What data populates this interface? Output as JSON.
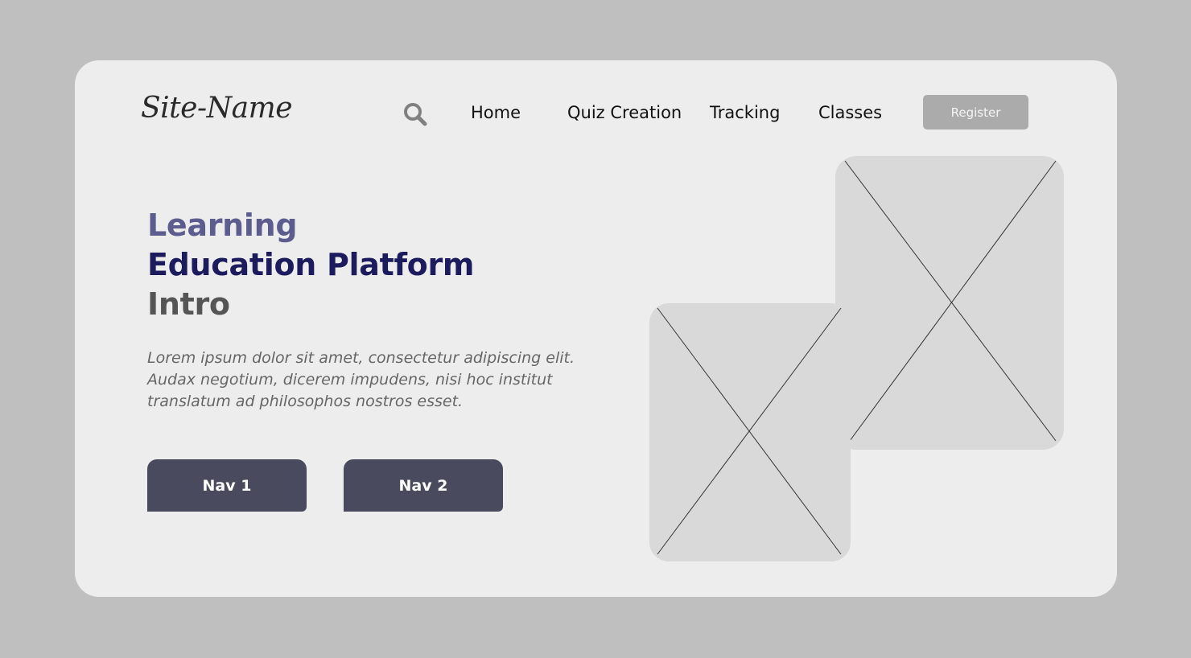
{
  "header": {
    "site_name": "Site-Name",
    "nav": [
      {
        "label": "Home"
      },
      {
        "label": "Quiz Creation"
      },
      {
        "label": "Tracking"
      },
      {
        "label": "Classes"
      }
    ],
    "register_label": "Register",
    "search_icon": "search-icon"
  },
  "hero": {
    "line1": "Learning",
    "line2": "Education Platform",
    "line3": "Intro",
    "description": [
      "Lorem ipsum dolor sit amet, consectetur adipiscing elit.",
      "Audax negotium, dicerem impudens, nisi hoc institut",
      "translatum ad philosophos nostros esset."
    ],
    "buttons": [
      {
        "label": "Nav 1"
      },
      {
        "label": "Nav 2"
      }
    ]
  },
  "colors": {
    "background": "#bfbfbf",
    "card": "#ededed",
    "accent_light": "#5c5c8e",
    "accent_dark": "#1b1b5e",
    "button": "#4a4a5f",
    "register": "#ababab",
    "image_placeholder": "#d9d9d9"
  }
}
